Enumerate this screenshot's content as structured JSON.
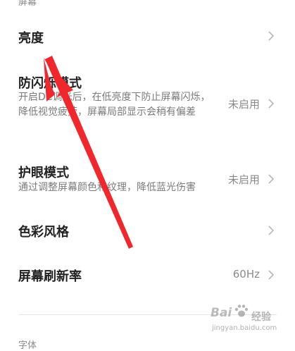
{
  "section_header": "屏幕",
  "settings": {
    "brightness": {
      "title": "亮度"
    },
    "anti_flicker": {
      "title": "防闪烁模式",
      "description": "开启DC调光后，在低亮度下防止屏幕闪烁，降低视觉疲劳，屏幕局部显示会稍有偏差",
      "value": "未启用"
    },
    "eye_care": {
      "title": "护眼模式",
      "description": "通过调整屏幕颜色和纹理，降低蓝光伤害",
      "value": "未启用"
    },
    "color_style": {
      "title": "色彩风格"
    },
    "refresh_rate": {
      "title": "屏幕刷新率",
      "value": "60Hz"
    }
  },
  "next_section_header": "字体",
  "watermark": {
    "logo": "Bai",
    "name": "经验",
    "url": "jingyan.baidu.com"
  },
  "colors": {
    "annotation_arrow": "#f0282d",
    "title_text": "#222222",
    "secondary_text": "#8a8a8a"
  },
  "icons": {
    "row_chevron": "chevron-right-icon",
    "annotation": "red-arrow-annotation"
  }
}
